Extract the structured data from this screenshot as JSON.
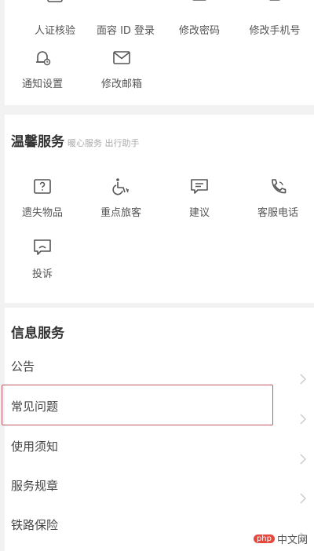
{
  "account": {
    "items": [
      {
        "label": "人证核验",
        "icon": "id-check-icon"
      },
      {
        "label": "面容 ID 登录",
        "icon": "face-id-icon"
      },
      {
        "label": "修改密码",
        "icon": "password-icon"
      },
      {
        "label": "修改手机号",
        "icon": "phone-edit-icon"
      },
      {
        "label": "通知设置",
        "icon": "bell-settings-icon"
      },
      {
        "label": "修改邮箱",
        "icon": "mail-icon"
      }
    ]
  },
  "warm_service": {
    "title": "温馨服务",
    "subtitle": "暖心服务 出行助手",
    "items": [
      {
        "label": "遗失物品",
        "icon": "question-box-icon"
      },
      {
        "label": "重点旅客",
        "icon": "wheelchair-icon"
      },
      {
        "label": "建议",
        "icon": "message-icon"
      },
      {
        "label": "客服电话",
        "icon": "phone-icon"
      },
      {
        "label": "投诉",
        "icon": "complaint-icon"
      }
    ]
  },
  "info_service": {
    "title": "信息服务",
    "items": [
      {
        "label": "公告"
      },
      {
        "label": "常见问题"
      },
      {
        "label": "使用须知"
      },
      {
        "label": "服务规章"
      },
      {
        "label": "铁路保险"
      }
    ]
  },
  "watermark": {
    "badge": "php",
    "text": "中文网"
  }
}
